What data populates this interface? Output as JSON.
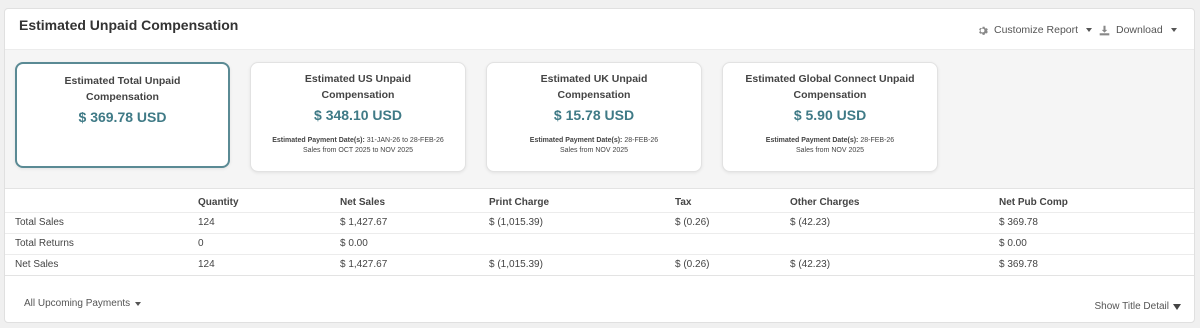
{
  "header": {
    "title": "Estimated Unpaid Compensation",
    "customize_label": "Customize Report",
    "download_label": "Download"
  },
  "cards": [
    {
      "title": "Estimated Total Unpaid Compensation",
      "amount": "$ 369.78 USD",
      "selected": true
    },
    {
      "title": "Estimated US Unpaid Compensation",
      "amount": "$ 348.10 USD",
      "payment_label": "Estimated Payment Date(s):",
      "payment_dates": " 31-JAN-26 to 28-FEB-26",
      "sales_period": "Sales from OCT 2025 to NOV 2025"
    },
    {
      "title": "Estimated UK Unpaid Compensation",
      "amount": "$ 15.78 USD",
      "payment_label": "Estimated Payment Date(s):",
      "payment_dates": " 28-FEB-26",
      "sales_period": "Sales from NOV 2025"
    },
    {
      "title": "Estimated Global Connect Unpaid Compensation",
      "amount": "$ 5.90 USD",
      "payment_label": "Estimated Payment Date(s):",
      "payment_dates": " 28-FEB-26",
      "sales_period": "Sales from NOV 2025"
    }
  ],
  "table": {
    "columns": [
      "",
      "Quantity",
      "Net Sales",
      "Print Charge",
      "Tax",
      "Other Charges",
      "Net Pub Comp"
    ],
    "rows": [
      [
        "Total Sales",
        "124",
        "$ 1,427.67",
        "$ (1,015.39)",
        "$ (0.26)",
        "$ (42.23)",
        "$ 369.78"
      ],
      [
        "Total Returns",
        "0",
        "$ 0.00",
        "",
        "",
        "",
        "$ 0.00"
      ],
      [
        "Net Sales",
        "124",
        "$ 1,427.67",
        "$ (1,015.39)",
        "$ (0.26)",
        "$ (42.23)",
        "$ 369.78"
      ]
    ]
  },
  "footer": {
    "payments_filter": "All Upcoming Payments",
    "show_detail": "Show Title Detail"
  },
  "colors": {
    "accent": "#3f7a86",
    "selected_border": "#5a8a94"
  },
  "icons": {
    "customize": "gear-icon",
    "download": "download-icon"
  }
}
